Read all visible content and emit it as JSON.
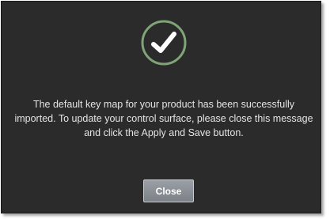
{
  "dialog": {
    "icon": "check-circle-icon",
    "message": "The default key map for your product has been successfully imported. To update your control surface, please close this message and click the Apply and Save button.",
    "close_label": "Close"
  },
  "colors": {
    "dialog_background": "#2b2b2b",
    "icon_ring": "#7fa477",
    "check_mark": "#ffffff",
    "text": "#e4e4e4",
    "button": "#8a8f95"
  }
}
